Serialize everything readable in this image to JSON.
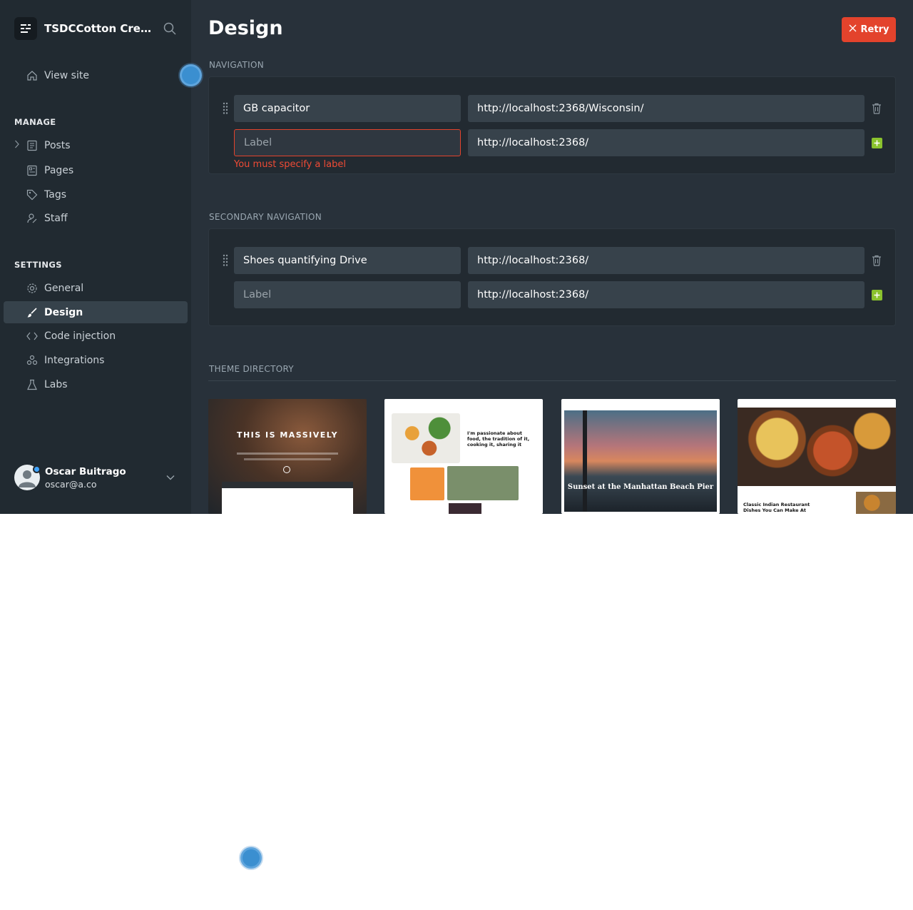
{
  "sidebar": {
    "brand": "TSDCCotton Creati...",
    "view_site": "View site",
    "manage_title": "MANAGE",
    "manage_items": [
      "Posts",
      "Pages",
      "Tags",
      "Staff"
    ],
    "settings_title": "SETTINGS",
    "settings_items": [
      "General",
      "Design",
      "Code injection",
      "Integrations",
      "Labs"
    ],
    "active_item": "Design",
    "user": {
      "name": "Oscar Buitrago",
      "email": "oscar@a.co"
    }
  },
  "main": {
    "title": "Design",
    "retry_label": "Retry",
    "navigation": {
      "title": "NAVIGATION",
      "items": [
        {
          "label": "GB capacitor",
          "url": "http://localhost:2368/Wisconsin/"
        }
      ],
      "new_item": {
        "label_placeholder": "Label",
        "url": "http://localhost:2368/"
      },
      "error": "You must specify a label"
    },
    "secondary_navigation": {
      "title": "SECONDARY NAVIGATION",
      "items": [
        {
          "label": "Shoes quantifying Drive",
          "url": "http://localhost:2368/"
        }
      ],
      "new_item": {
        "label_placeholder": "Label",
        "url": "http://localhost:2368/"
      }
    },
    "theme_directory": {
      "title": "THEME DIRECTORY",
      "themes": [
        {
          "headline": "THIS IS MASSIVELY"
        },
        {
          "headline": "I'm passionate about food, the tradition of it, cooking it, sharing it"
        },
        {
          "headline": "Sunset at the Manhattan Beach Pier"
        },
        {
          "headline": "Classic Indian Restaurant Dishes You Can Make At"
        }
      ]
    }
  },
  "colors": {
    "accent_red": "#e3432c",
    "add_green": "#8ac22d",
    "sidebar_bg": "#212a31",
    "main_bg": "#28313a"
  }
}
